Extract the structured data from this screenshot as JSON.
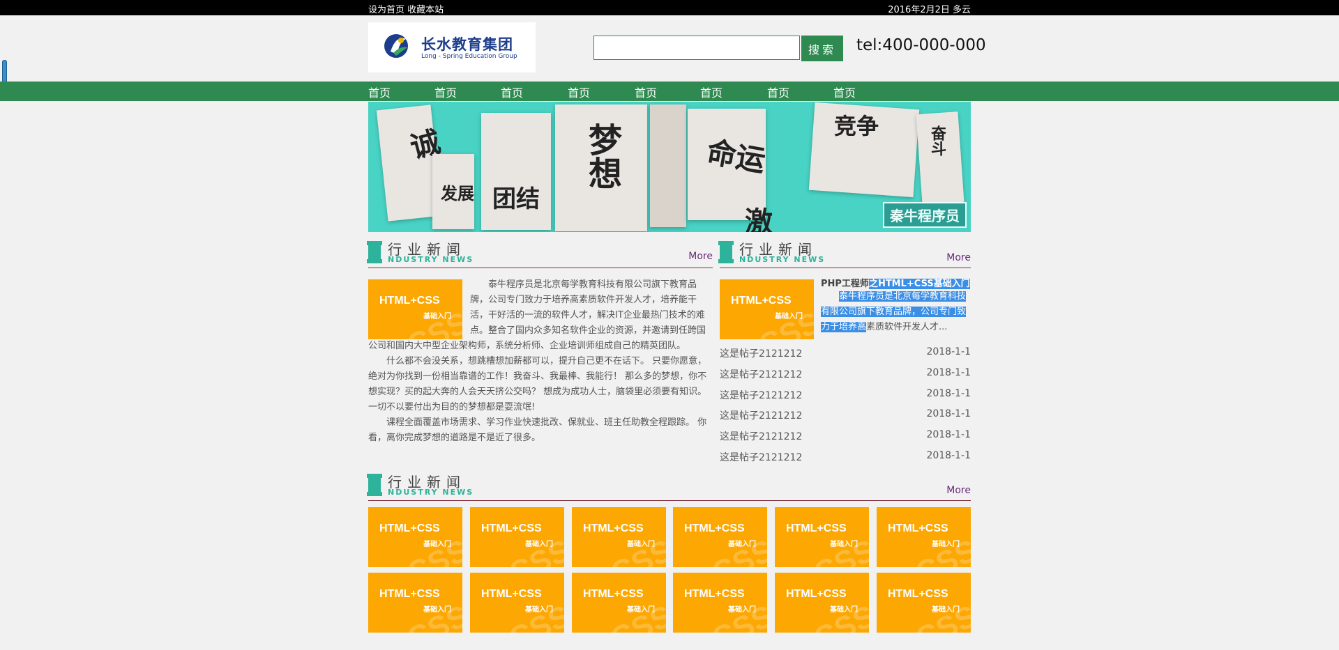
{
  "topbar": {
    "left": "设为首页 收藏本站",
    "right": "2016年2月2日 多云"
  },
  "logo": {
    "cn": "长水教育集团",
    "en": "Long - Spring Education Group"
  },
  "search": {
    "placeholder": "",
    "button": "搜索"
  },
  "tel": "tel:400-000-000",
  "nav": [
    "首页",
    "首页",
    "首页",
    "首页",
    "首页",
    "首页",
    "首页",
    "首页"
  ],
  "banner": {
    "chars": [
      "诚",
      "梦想",
      "团结",
      "发展",
      "命运",
      "竞争",
      "激",
      "奋斗"
    ],
    "tag": "秦牛程序员"
  },
  "section": {
    "title": "行业新闻",
    "sub": "NDUSTRY NEWS",
    "more": "More"
  },
  "thumb": {
    "line1": "HTML+CSS",
    "line2": "基础入门",
    "wm": "CSS"
  },
  "article": [
    "泰牛程序员是北京每学教育科技有限公司旗下教育品牌，公司专门致力于培养高素质软件开发人才，培养能干活，干好活的一流的软件人才，解决IT企业最热门技术的难点。整合了国内众多知名软件企业的资源，并邀请到任跨国公司和国内大中型企业架构师，系统分析师、企业培训师组成自己的精英团队。",
    "什么都不会没关系，想跳槽想加薪都可以，提升自己更不在话下。 只要你愿意，绝对为你找到一份相当靠谱的工作！我奋斗、我最棒、我能行！ 那么多的梦想，你不想实现？买的起大奔的人会天天挤公交吗？ 想成为成功人士，脑袋里必须要有知识。一切不以要付出为目的的梦想都是耍流氓!",
    "课程全面覆盖市场需求、学习作业快速批改、保就业、班主任助教全程跟踪。 你看，离你完成梦想的道路是不是近了很多。"
  ],
  "right_news": {
    "title_plain": "PHP工程师",
    "title_highlight": "之HTML+CSS基础入门",
    "desc_highlight": "泰牛程序员是北京每学教育科技有限公司旗下教育品牌，公司专门致力于培养高",
    "desc_plain": "素质软件开发人才..."
  },
  "list": [
    {
      "title": "这是帖子2121212",
      "date": "2018-1-1"
    },
    {
      "title": "这是帖子2121212",
      "date": "2018-1-1"
    },
    {
      "title": "这是帖子2121212",
      "date": "2018-1-1"
    },
    {
      "title": "这是帖子2121212",
      "date": "2018-1-1"
    },
    {
      "title": "这是帖子2121212",
      "date": "2018-1-1"
    },
    {
      "title": "这是帖子2121212",
      "date": "2018-1-1"
    }
  ],
  "colors": {
    "green": "#2e8a50",
    "teal": "#2db39b",
    "orange": "#fca702",
    "highlight": "#3a8ee6"
  }
}
